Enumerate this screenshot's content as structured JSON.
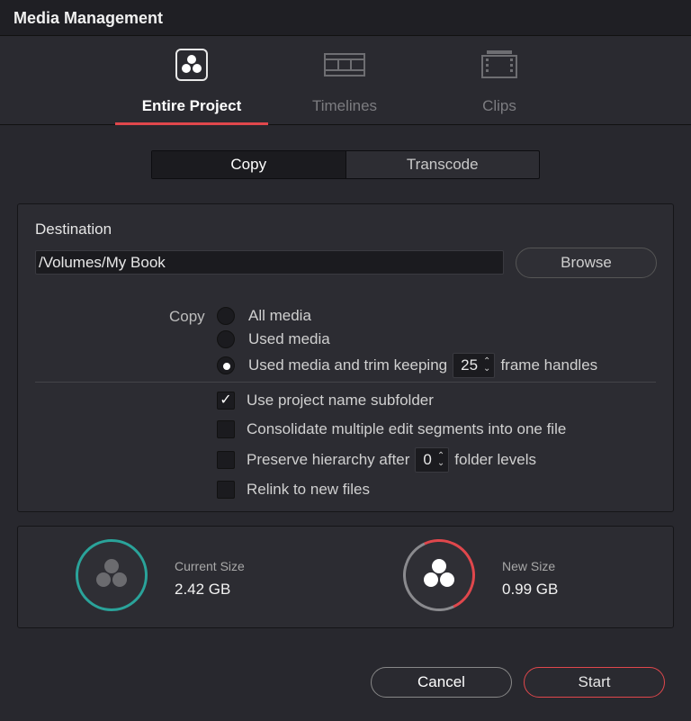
{
  "window": {
    "title": "Media Management"
  },
  "modes": [
    {
      "label": "Entire Project",
      "icon": "resolve-logo-icon",
      "active": true
    },
    {
      "label": "Timelines",
      "icon": "timeline-icon",
      "active": false
    },
    {
      "label": "Clips",
      "icon": "clips-icon",
      "active": false
    }
  ],
  "segment": {
    "copy": "Copy",
    "transcode": "Transcode",
    "active": "Copy"
  },
  "destination": {
    "label": "Destination",
    "path": "/Volumes/My Book",
    "browse": "Browse"
  },
  "copy_options": {
    "label": "Copy",
    "all_media": "All media",
    "used_media": "Used media",
    "used_trim_prefix": "Used media and trim keeping",
    "handles_value": "25",
    "used_trim_suffix": "frame handles",
    "selected": "used_trim"
  },
  "checkboxes": {
    "subfolder": {
      "label": "Use project name subfolder",
      "checked": true
    },
    "consolidate": {
      "label": "Consolidate multiple edit segments into one file",
      "checked": false
    },
    "preserve_prefix": "Preserve hierarchy after",
    "preserve_value": "0",
    "preserve_suffix": "folder levels",
    "preserve_checked": false,
    "relink": {
      "label": "Relink to new files",
      "checked": false
    }
  },
  "sizes": {
    "current_label": "Current Size",
    "current_value": "2.42 GB",
    "new_label": "New Size",
    "new_value": "0.99 GB",
    "current_ring_color": "#2aa39a",
    "new_ring_color": "#e0474c"
  },
  "actions": {
    "cancel": "Cancel",
    "start": "Start"
  },
  "colors": {
    "accent": "#e0474c",
    "teal": "#2aa39a"
  }
}
